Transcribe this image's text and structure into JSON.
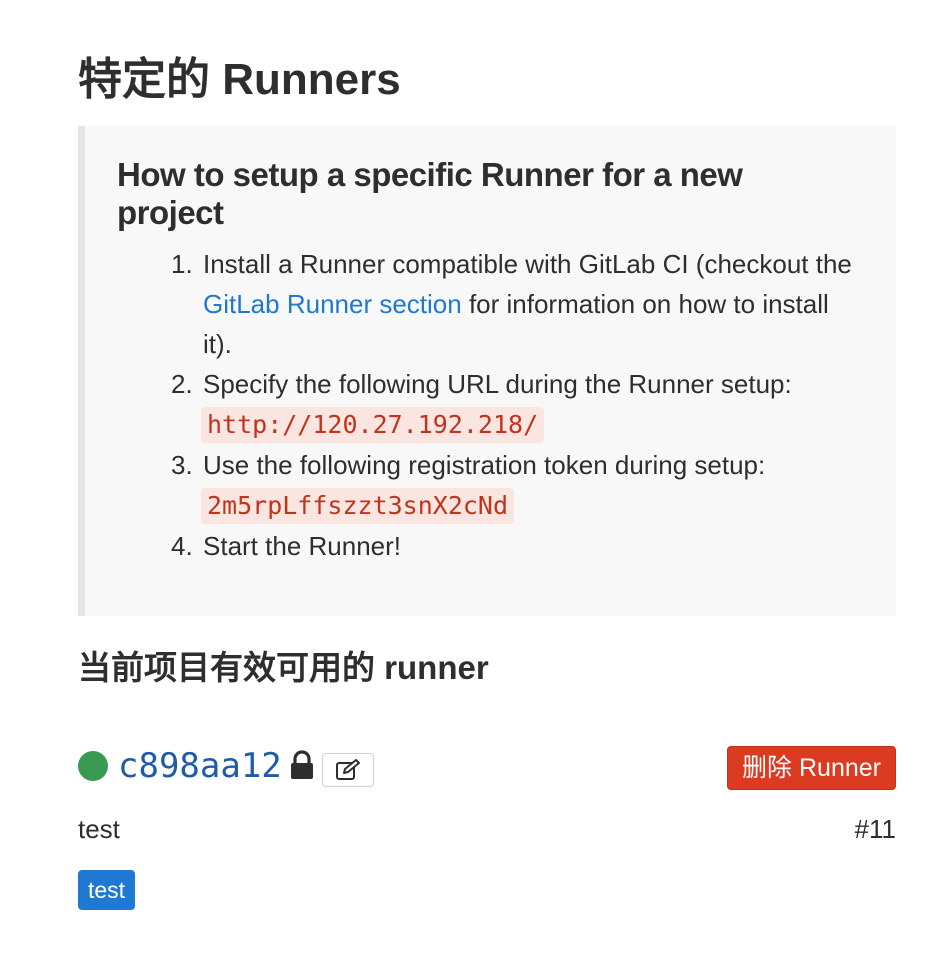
{
  "page": {
    "title": "特定的 Runners"
  },
  "setup": {
    "heading": "How to setup a specific Runner for a new project",
    "steps": [
      {
        "number": "1.",
        "text_before": "Install a Runner compatible with GitLab CI (checkout the ",
        "link_text": "GitLab Runner section",
        "text_after": " for information on how to install it)."
      },
      {
        "number": "2.",
        "text": "Specify the following URL during the Runner setup:",
        "code": "http://120.27.192.218/"
      },
      {
        "number": "3.",
        "text": "Use the following registration token during setup:",
        "code": "2m5rpLffszzt3snX2cNd"
      },
      {
        "number": "4.",
        "text": "Start the Runner!"
      }
    ]
  },
  "runners_section": {
    "title": "当前项目有效可用的 runner"
  },
  "runner": {
    "status": "online",
    "status_color": "#3a9a52",
    "id": "c898aa12",
    "lock_icon": "lock-icon",
    "edit_icon": "edit-icon",
    "delete_label": "删除 Runner",
    "description": "test",
    "number": "#11",
    "tags": [
      "test"
    ]
  },
  "colors": {
    "link": "#1f78d1",
    "danger": "#db3b21",
    "code_text": "#c0341d",
    "code_bg": "#fbe5e1",
    "tag_bg": "#1f78d1"
  }
}
